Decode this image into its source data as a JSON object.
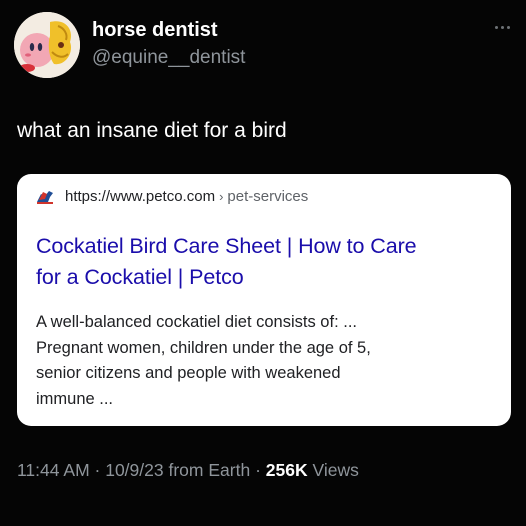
{
  "author": {
    "display_name": "horse dentist",
    "handle": "@equine__dentist"
  },
  "tweet": {
    "text": "what an insane diet for a bird"
  },
  "link_card": {
    "url": "https://www.petco.com",
    "separator": "›",
    "path": "pet-services",
    "title_line1": "Cockatiel Bird Care Sheet | How to Care",
    "title_line2": "for a Cockatiel | Petco",
    "snippet_lines": [
      "A well-balanced cockatiel diet consists of: ...",
      "Pregnant women, children under the age of 5,",
      "senior citizens and people with weakened",
      "immune ..."
    ],
    "favicon": "petco-dog-logo-icon"
  },
  "meta": {
    "time": "11:44 AM",
    "dot1": "·",
    "date": "10/9/23",
    "source": "from Earth",
    "dot2": "·",
    "views_count": "256K",
    "views_label": "Views"
  },
  "colors": {
    "background": "#050505",
    "card_title": "#1a0dab",
    "muted": "#8f959b",
    "petco_red": "#d0342c",
    "petco_blue": "#1f4e96"
  }
}
